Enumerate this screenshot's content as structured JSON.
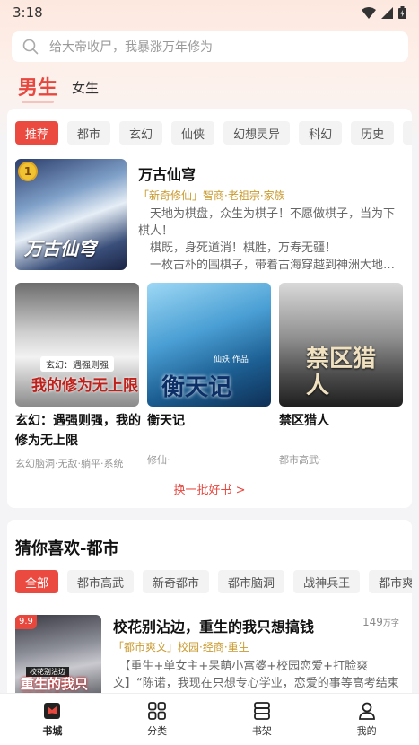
{
  "status_bar": {
    "time": "3:18"
  },
  "search": {
    "placeholder": "给大帝收尸，我暴涨万年修为"
  },
  "gender_tabs": [
    {
      "label": "男生"
    },
    {
      "label": "女生"
    }
  ],
  "featured": {
    "categories": [
      "推荐",
      "都市",
      "玄幻",
      "仙侠",
      "幻想灵异",
      "科幻",
      "历史",
      "军"
    ],
    "top_book": {
      "rank": "1",
      "title": "万古仙穹",
      "tags": "「新奇修仙」智商·老祖宗·家族",
      "description": "　天地为棋盘，众生为棋子！不愿做棋子，当为下棋人！\n　棋既，身死道消！棋胜，万寿无疆！\n　一枚古朴的围棋子，带着古海穿越到神洲大地…",
      "cover_text": "万古仙穹"
    },
    "books": [
      {
        "title": "玄幻：遇强则强，我的修为无上限",
        "tags": "玄幻脑洞·无敌·躺平·系统",
        "cover_text": "我的修为无上限",
        "cover_banner": "玄幻：遇强则强"
      },
      {
        "title": "衡天记",
        "tags": "修仙·",
        "cover_text": "衡天记",
        "cover_author": "仙妖·作品"
      },
      {
        "title": "禁区猎人",
        "tags": "都市高武·",
        "cover_text": "禁区猎人"
      }
    ],
    "more_link": "换一批好书 >"
  },
  "guess": {
    "title": "猜你喜欢-都市",
    "categories": [
      "全部",
      "都市高武",
      "新奇都市",
      "都市脑洞",
      "战神兵王",
      "都市爽文"
    ],
    "book": {
      "score": "9.9",
      "title": "校花别沾边，重生的我只想搞钱",
      "word_count": "149",
      "word_unit": "万字",
      "tags": "「都市爽文」校园·经商·重生",
      "description": "　【重生+单女主+呆萌小富婆+校园恋爱+打脸爽文】“陈诺，我现在只想专心学业，恋爱的事等高考结束了再说",
      "cover_text": "重生的我只想搞钱",
      "cover_banner": "校花别沾边"
    }
  },
  "bottom_nav": [
    {
      "label": "书城",
      "icon": "bookstore-icon"
    },
    {
      "label": "分类",
      "icon": "category-grid-icon"
    },
    {
      "label": "书架",
      "icon": "bookshelf-icon"
    },
    {
      "label": "我的",
      "icon": "profile-icon"
    }
  ],
  "colors": {
    "accent": "#e8473e",
    "tag": "#c99a2e"
  }
}
